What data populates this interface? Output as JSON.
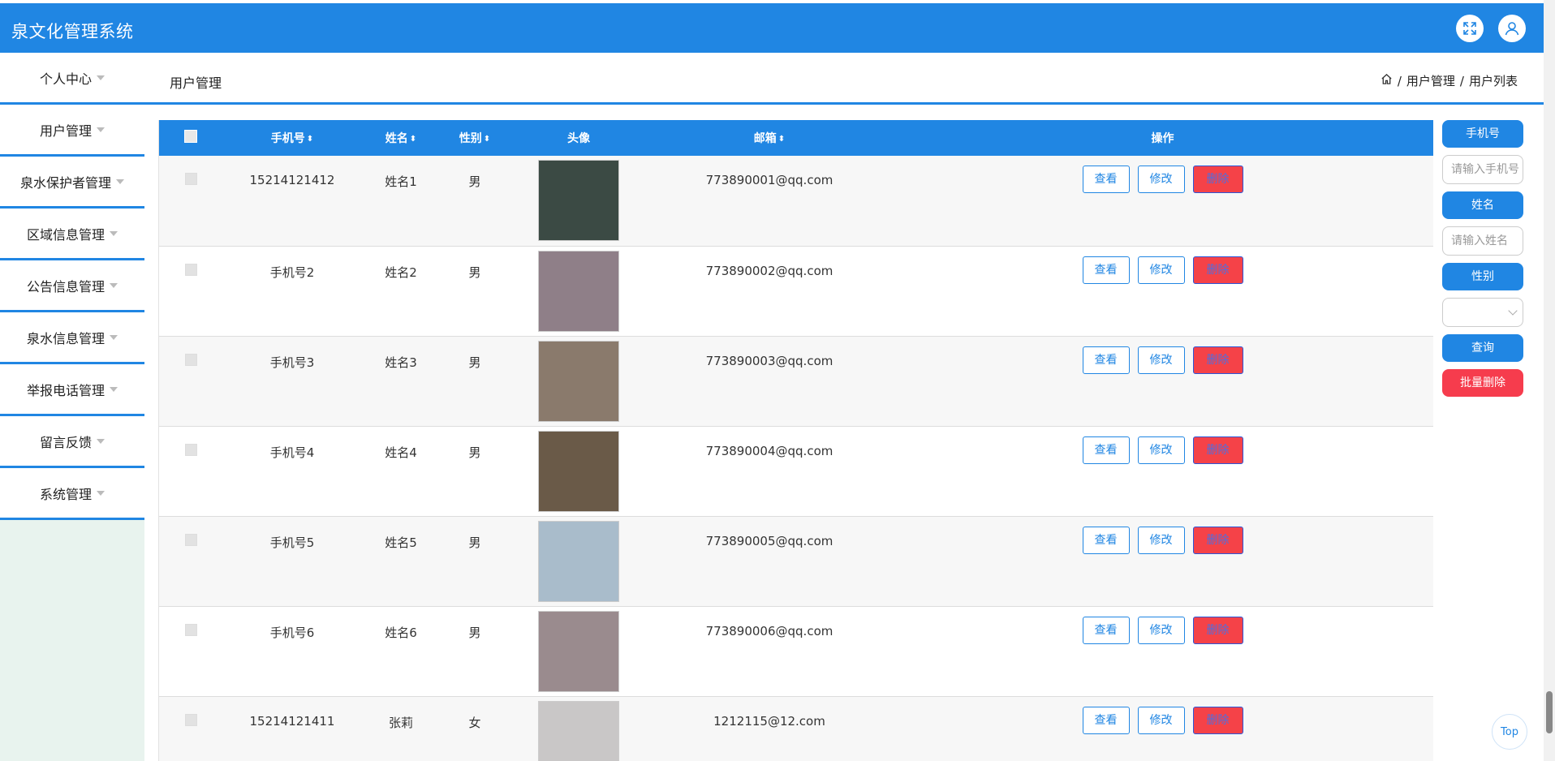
{
  "app": {
    "title": "泉文化管理系统"
  },
  "header_icons": {
    "fullscreen": "fullscreen-icon",
    "user": "user-icon"
  },
  "sidebar": {
    "items": [
      {
        "label": "个人中心"
      },
      {
        "label": "用户管理"
      },
      {
        "label": "泉水保护者管理"
      },
      {
        "label": "区域信息管理"
      },
      {
        "label": "公告信息管理"
      },
      {
        "label": "泉水信息管理"
      },
      {
        "label": "举报电话管理"
      },
      {
        "label": "留言反馈"
      },
      {
        "label": "系统管理"
      }
    ]
  },
  "subheader": {
    "title": "用户管理",
    "breadcrumb": [
      "用户管理",
      "用户列表"
    ],
    "separator": "/"
  },
  "table": {
    "columns": [
      "手机号",
      "姓名",
      "性别",
      "头像",
      "邮箱",
      "操作"
    ],
    "sortable": [
      "手机号",
      "姓名",
      "性别",
      "邮箱"
    ],
    "actions": {
      "view": "查看",
      "edit": "修改",
      "delete": "删除"
    },
    "rows": [
      {
        "phone": "15214121412",
        "name": "姓名1",
        "gender": "男",
        "email": "773890001@qq.com",
        "avatar_color": "#3b4a44"
      },
      {
        "phone": "手机号2",
        "name": "姓名2",
        "gender": "男",
        "email": "773890002@qq.com",
        "avatar_color": "#8f7f88"
      },
      {
        "phone": "手机号3",
        "name": "姓名3",
        "gender": "男",
        "email": "773890003@qq.com",
        "avatar_color": "#8a7a6c"
      },
      {
        "phone": "手机号4",
        "name": "姓名4",
        "gender": "男",
        "email": "773890004@qq.com",
        "avatar_color": "#6a5a48"
      },
      {
        "phone": "手机号5",
        "name": "姓名5",
        "gender": "男",
        "email": "773890005@qq.com",
        "avatar_color": "#a9bccb"
      },
      {
        "phone": "手机号6",
        "name": "姓名6",
        "gender": "男",
        "email": "773890006@qq.com",
        "avatar_color": "#9a8b8e"
      },
      {
        "phone": "15214121411",
        "name": "张莉",
        "gender": "女",
        "email": "1212115@12.com",
        "avatar_color": "#c9c7c7"
      }
    ]
  },
  "search_panel": {
    "phone_label": "手机号",
    "phone_placeholder": "请输入手机号",
    "name_label": "姓名",
    "name_placeholder": "请输入姓名",
    "gender_label": "性别",
    "gender_value": "",
    "query_button": "查询",
    "batch_delete_button": "批量删除"
  },
  "back_to_top": "Top",
  "colors": {
    "primary": "#2086e3",
    "danger": "#f54248",
    "sidebar_bg": "#e8f3ee"
  }
}
